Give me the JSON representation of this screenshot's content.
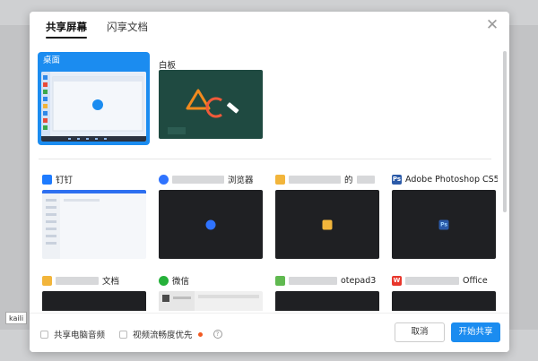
{
  "tabs": [
    {
      "label": "共享屏幕",
      "active": true
    },
    {
      "label": "闪享文档",
      "active": false
    }
  ],
  "close_glyph": "✕",
  "top_sources": [
    {
      "label": "桌面",
      "selected": true
    },
    {
      "label": "白板",
      "selected": false
    }
  ],
  "windows": [
    {
      "label": "钉钉",
      "icon": "dingtalk-icon",
      "color": "#1e7bff"
    },
    {
      "label": "浏览器",
      "icon": "browser-icon",
      "color": "#2f73ff"
    },
    {
      "label": "的",
      "icon": "folder-icon",
      "color": "#f2b53b"
    },
    {
      "label": "Adobe Photoshop CS5",
      "icon": "photoshop-icon",
      "color": "#2b5aa8",
      "icon_text": "Ps"
    },
    {
      "label": "文档",
      "icon": "folder-icon",
      "color": "#f2b53b"
    },
    {
      "label": "微信",
      "icon": "wechat-icon",
      "color": "#25b13a"
    },
    {
      "label": "otepad3",
      "icon": "notepad-icon",
      "color": "#60b950"
    },
    {
      "label": "Office",
      "icon": "wps-office-icon",
      "color": "#e8372c",
      "icon_text": "W"
    }
  ],
  "footer": {
    "share_audio": "共享电脑音频",
    "smooth_video": "视频流畅度优先",
    "help": "?",
    "cancel": "取消",
    "start": "开始共享"
  },
  "user_tag": "kaili"
}
